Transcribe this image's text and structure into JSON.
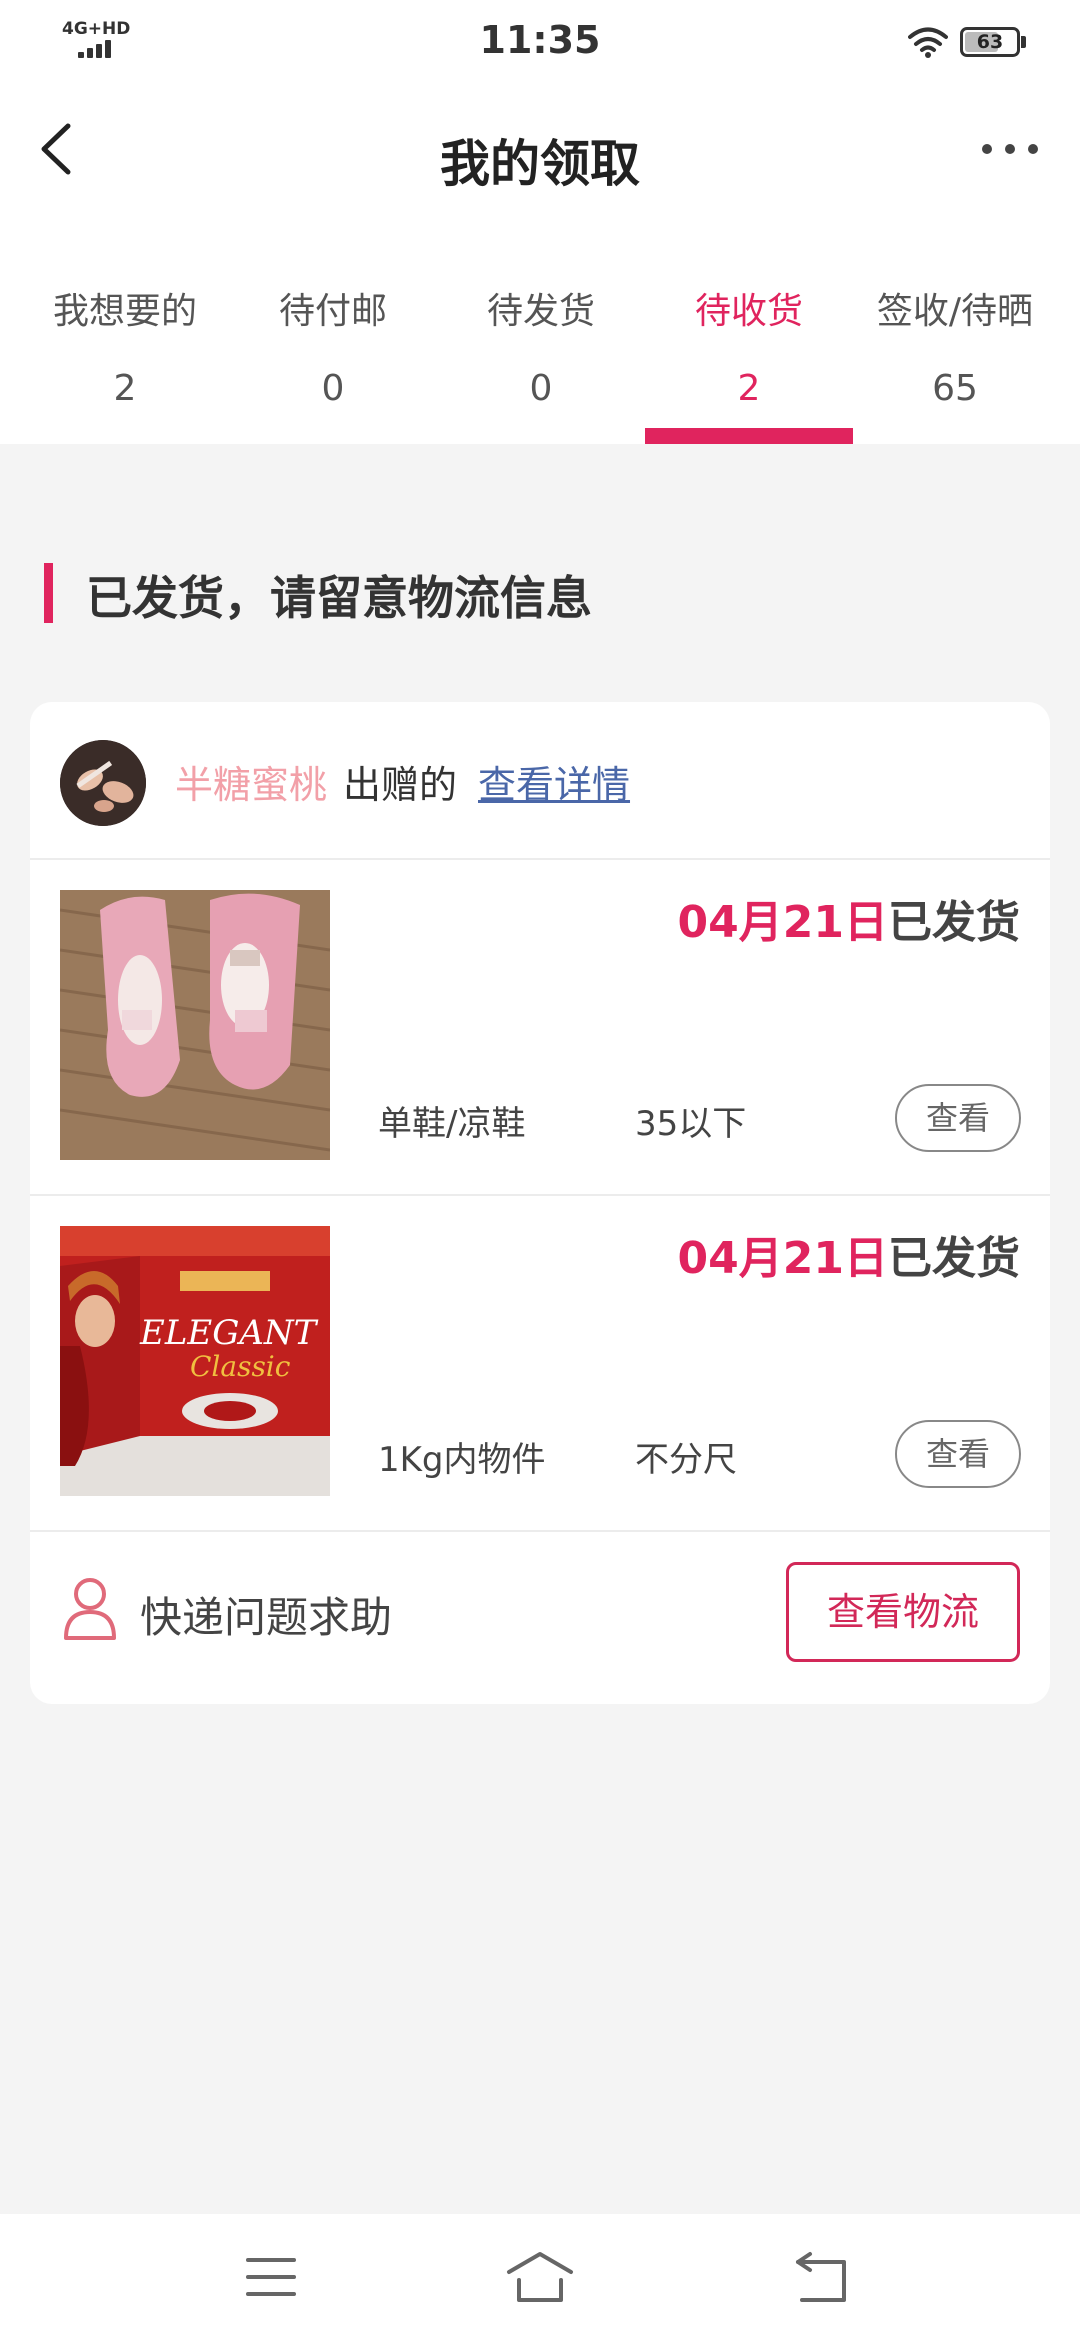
{
  "status_bar": {
    "network": "4G+HD",
    "time": "11:35",
    "battery": "63"
  },
  "header": {
    "title": "我的领取"
  },
  "tabs": [
    {
      "label": "我想要的",
      "count": "2"
    },
    {
      "label": "待付邮",
      "count": "0"
    },
    {
      "label": "待发货",
      "count": "0"
    },
    {
      "label": "待收货",
      "count": "2",
      "active": true
    },
    {
      "label": "签收/待晒",
      "count": "65"
    }
  ],
  "section": {
    "title": "已发货，请留意物流信息"
  },
  "card": {
    "giver_name": "半糖蜜桃",
    "giver_suffix": "出赠的",
    "detail_link": "查看详情",
    "items": [
      {
        "date": "04月21日",
        "status": "已发货",
        "category": "单鞋/凉鞋",
        "size": "35以下",
        "view_label": "查看",
        "image": "pink-shoes-photo"
      },
      {
        "date": "04月21日",
        "status": "已发货",
        "category": "1Kg内物件",
        "size": "不分尺",
        "view_label": "查看",
        "image": "red-gift-box-photo"
      }
    ],
    "help_text": "快递问题求助",
    "logistics_button": "查看物流"
  },
  "colors": {
    "accent": "#e0245e",
    "giver_name": "#f2a0a8",
    "link": "#4a67a8",
    "background": "#f4f4f4"
  },
  "icons": [
    "back-arrow-icon",
    "more-dots-icon",
    "user-icon",
    "menu-icon",
    "home-icon",
    "back-icon",
    "wifi-icon",
    "battery-icon",
    "signal-icon"
  ]
}
